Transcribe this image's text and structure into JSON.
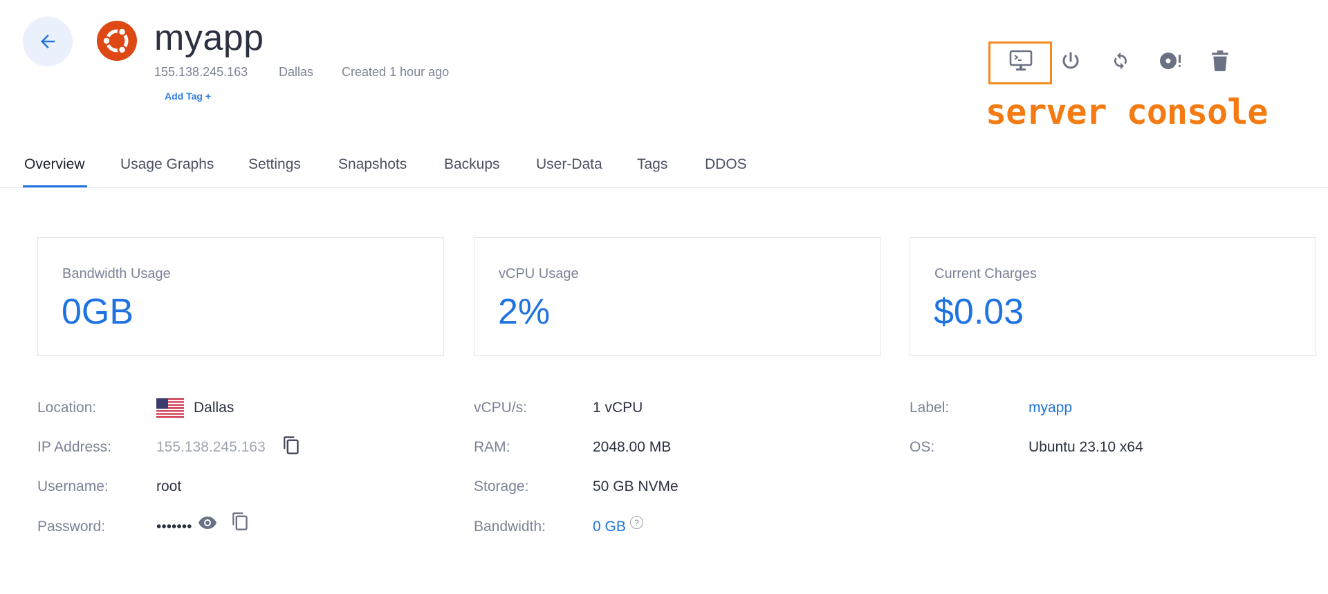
{
  "header": {
    "title": "myapp",
    "ip": "155.138.245.163",
    "location": "Dallas",
    "created": "Created 1 hour ago",
    "add_tag_label": "Add Tag +"
  },
  "actions": [
    {
      "name": "server-console",
      "icon": "monitor-icon"
    },
    {
      "name": "power",
      "icon": "power-icon"
    },
    {
      "name": "restart",
      "icon": "refresh-icon"
    },
    {
      "name": "reinstall",
      "icon": "disc-alert-icon"
    },
    {
      "name": "destroy",
      "icon": "trash-icon"
    }
  ],
  "annotation": {
    "text": "server console",
    "color": "#f37b12"
  },
  "tabs": [
    {
      "label": "Overview",
      "active": true
    },
    {
      "label": "Usage Graphs"
    },
    {
      "label": "Settings"
    },
    {
      "label": "Snapshots"
    },
    {
      "label": "Backups"
    },
    {
      "label": "User-Data"
    },
    {
      "label": "Tags"
    },
    {
      "label": "DDOS"
    }
  ],
  "cards": [
    {
      "label": "Bandwidth Usage",
      "value": "0GB"
    },
    {
      "label": "vCPU Usage",
      "value": "2%"
    },
    {
      "label": "Current Charges",
      "value": "$0.03"
    }
  ],
  "details": {
    "location": {
      "label": "Location:",
      "value": "Dallas"
    },
    "ip": {
      "label": "IP Address:",
      "value": "155.138.245.163"
    },
    "username": {
      "label": "Username:",
      "value": "root"
    },
    "password": {
      "label": "Password:",
      "value": "•••••••"
    },
    "vcpus": {
      "label": "vCPU/s:",
      "value": "1 vCPU"
    },
    "ram": {
      "label": "RAM:",
      "value": "2048.00 MB"
    },
    "storage": {
      "label": "Storage:",
      "value": "50 GB NVMe"
    },
    "bandwidth": {
      "label": "Bandwidth:",
      "value": "0 GB",
      "help": "?"
    },
    "label": {
      "label": "Label:",
      "value": "myapp"
    },
    "os": {
      "label": "OS:",
      "value": "Ubuntu 23.10 x64"
    }
  },
  "colors": {
    "accent": "#1f73e0",
    "ubuntu": "#dd4814",
    "highlight": "#f38a1d"
  }
}
